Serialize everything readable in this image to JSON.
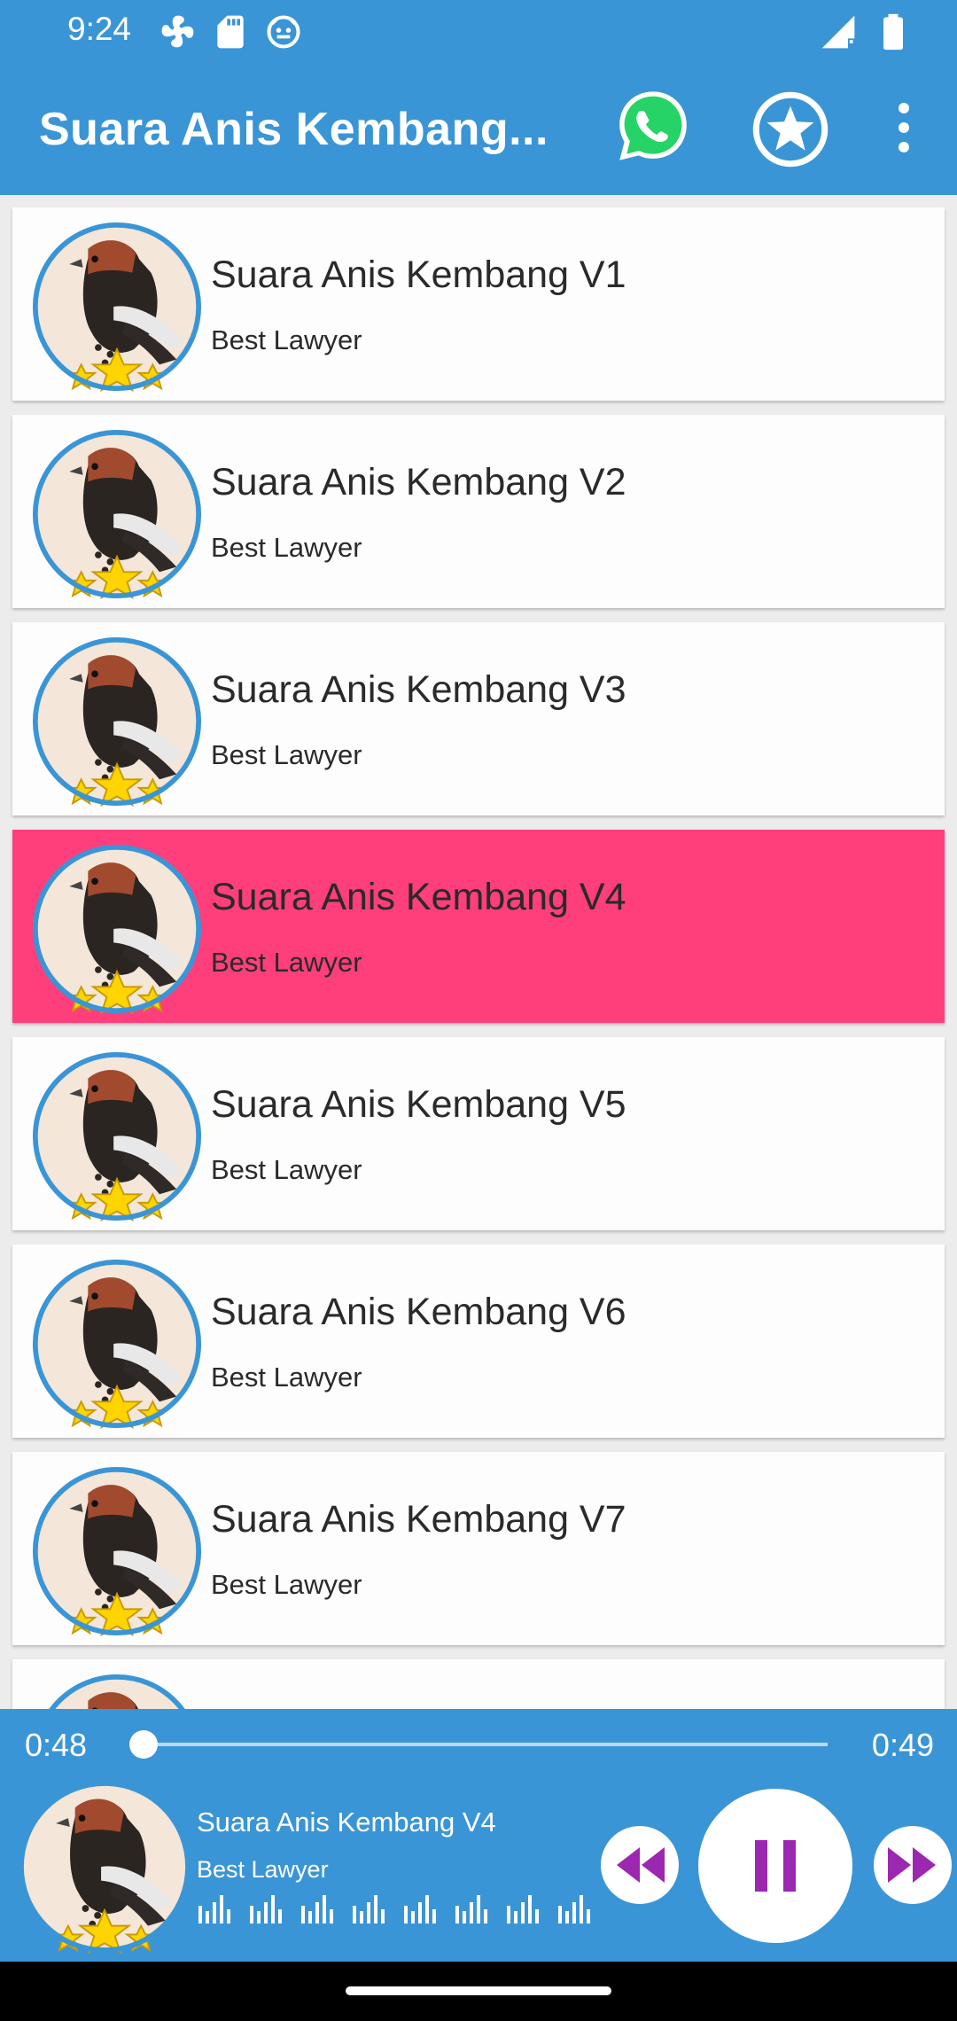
{
  "status_bar": {
    "time": "9:24",
    "left_icons": [
      "fan-icon",
      "sd-card-icon",
      "face-icon"
    ],
    "right_icons": [
      "signal-icon",
      "battery-icon"
    ]
  },
  "app_bar": {
    "title": "Suara Anis Kembang...",
    "background": "#3a95d6",
    "actions": [
      "whatsapp-icon",
      "star-icon",
      "more-vert-icon"
    ]
  },
  "songs": [
    {
      "title": "Suara Anis Kembang V1",
      "artist": "Best Lawyer"
    },
    {
      "title": "Suara Anis Kembang V2",
      "artist": "Best Lawyer"
    },
    {
      "title": "Suara Anis Kembang V3",
      "artist": "Best Lawyer"
    },
    {
      "title": "Suara Anis Kembang V4",
      "artist": "Best Lawyer",
      "active": true
    },
    {
      "title": "Suara Anis Kembang V5",
      "artist": "Best Lawyer"
    },
    {
      "title": "Suara Anis Kembang V6",
      "artist": "Best Lawyer"
    },
    {
      "title": "Suara Anis Kembang V7",
      "artist": "Best Lawyer"
    }
  ],
  "active_color": "#fe3f7b",
  "player": {
    "current_time": "0:48",
    "total_time": "0:49",
    "progress": 0.0,
    "now_playing_title": "Suara Anis Kembang V4",
    "now_playing_artist": "Best Lawyer",
    "controls": [
      "rewind-icon",
      "pause-icon",
      "fast-forward-icon"
    ],
    "accent": "#9c27b0"
  }
}
